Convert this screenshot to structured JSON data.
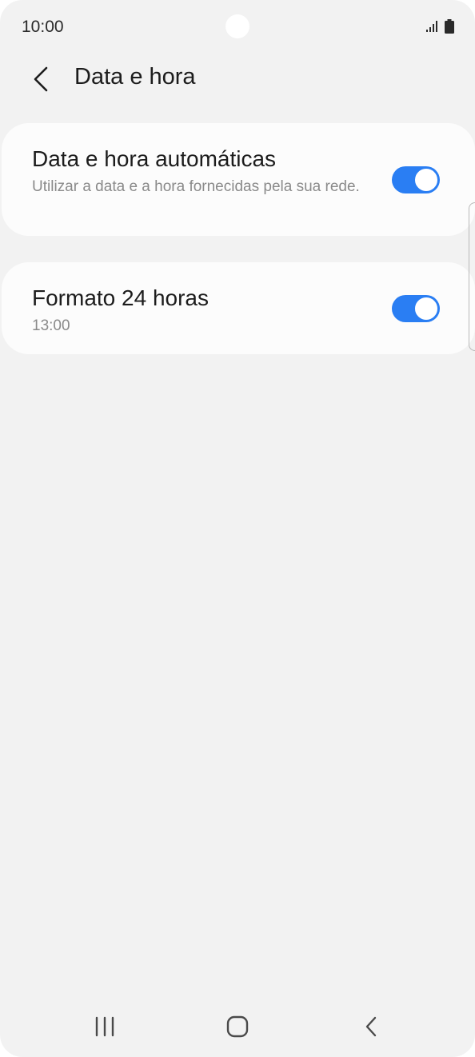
{
  "status_bar": {
    "time": "10:00",
    "signal_icon": "signal-icon",
    "battery_icon": "battery-icon"
  },
  "header": {
    "back_icon": "chevron-left-icon",
    "title": "Data e hora"
  },
  "settings": [
    {
      "title": "Data e hora automáticas",
      "subtitle": "Utilizar a data e a hora fornecidas pela sua rede.",
      "enabled": true
    },
    {
      "title": "Formato 24 horas",
      "subtitle": "13:00",
      "enabled": true
    }
  ],
  "nav_bar": {
    "recents_icon": "recents-icon",
    "home_icon": "home-icon",
    "back_icon": "back-icon"
  },
  "colors": {
    "accent": "#2a7ef3",
    "background": "#f2f2f2",
    "card": "#fcfcfc",
    "subtitle": "#8a8a8a"
  }
}
